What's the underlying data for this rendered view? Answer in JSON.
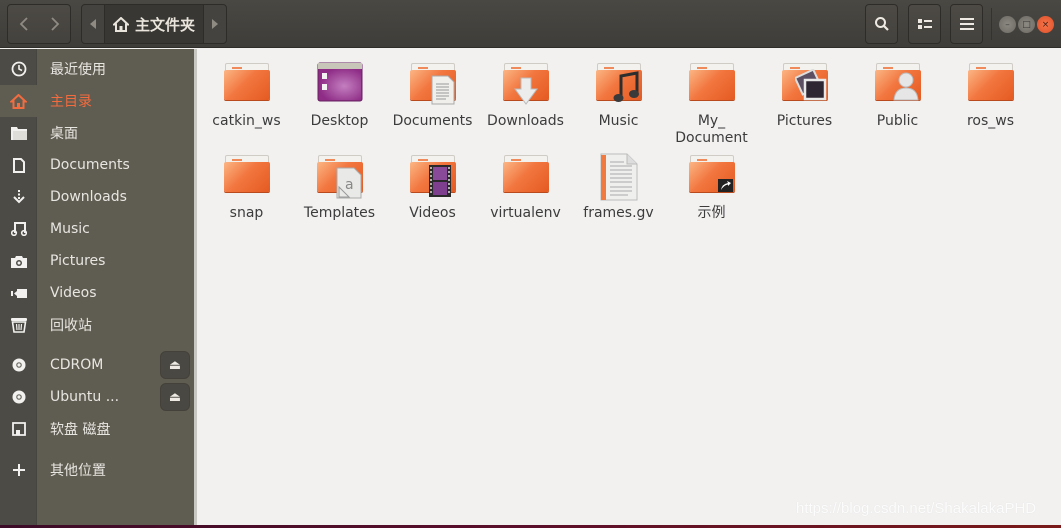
{
  "header": {
    "back_icon": "chevron-left-icon",
    "forward_icon": "chevron-right-icon",
    "path_prev_icon": "triangle-left-icon",
    "path_next_icon": "triangle-right-icon",
    "current_location": "主文件夹",
    "current_location_icon": "home-icon",
    "search_icon": "search-icon",
    "view_icon": "view-toggle-icon",
    "menu_icon": "hamburger-menu-icon",
    "window_controls": {
      "minimize": "–",
      "maximize": "□",
      "close": "×"
    }
  },
  "sidebar": {
    "items": [
      {
        "label": "最近使用",
        "icon": "clock-icon",
        "active": false
      },
      {
        "label": "主目录",
        "icon": "home-icon",
        "active": true
      },
      {
        "label": "桌面",
        "icon": "folder-icon",
        "active": false
      },
      {
        "label": "Documents",
        "icon": "document-icon",
        "active": false
      },
      {
        "label": "Downloads",
        "icon": "download-icon",
        "active": false
      },
      {
        "label": "Music",
        "icon": "music-icon",
        "active": false
      },
      {
        "label": "Pictures",
        "icon": "camera-icon",
        "active": false
      },
      {
        "label": "Videos",
        "icon": "video-icon",
        "active": false
      },
      {
        "label": "回收站",
        "icon": "trash-icon",
        "active": false
      },
      {
        "label": "CDROM",
        "icon": "disc-icon",
        "active": false,
        "eject": true
      },
      {
        "label": "Ubuntu ...",
        "icon": "disc-icon",
        "active": false,
        "eject": true
      },
      {
        "label": "软盘 磁盘",
        "icon": "floppy-icon",
        "active": false
      },
      {
        "label": "其他位置",
        "icon": "plus-icon",
        "active": false
      }
    ],
    "eject_glyph": "⏏"
  },
  "files": [
    {
      "name": "catkin_ws",
      "type": "folder",
      "emblem": ""
    },
    {
      "name": "Desktop",
      "type": "desktop-folder",
      "emblem": ""
    },
    {
      "name": "Documents",
      "type": "folder",
      "emblem": "document"
    },
    {
      "name": "Downloads",
      "type": "folder",
      "emblem": "download"
    },
    {
      "name": "Music",
      "type": "folder",
      "emblem": "music"
    },
    {
      "name": "My_ Document",
      "type": "folder",
      "emblem": ""
    },
    {
      "name": "Pictures",
      "type": "folder",
      "emblem": "pictures"
    },
    {
      "name": "Public",
      "type": "folder",
      "emblem": "person"
    },
    {
      "name": "ros_ws",
      "type": "folder",
      "emblem": ""
    },
    {
      "name": "snap",
      "type": "folder",
      "emblem": ""
    },
    {
      "name": "Templates",
      "type": "folder",
      "emblem": "template"
    },
    {
      "name": "Videos",
      "type": "folder",
      "emblem": "film"
    },
    {
      "name": "virtualenv",
      "type": "folder",
      "emblem": ""
    },
    {
      "name": "frames.gv",
      "type": "text-file",
      "emblem": ""
    },
    {
      "name": "示例",
      "type": "folder",
      "emblem": "symlink"
    }
  ],
  "watermark": "https://blog.csdn.net/ShakalakaPHD",
  "colors": {
    "accent": "#f26c3f",
    "sidebar": "#5f5c51",
    "header": "#42403c"
  }
}
